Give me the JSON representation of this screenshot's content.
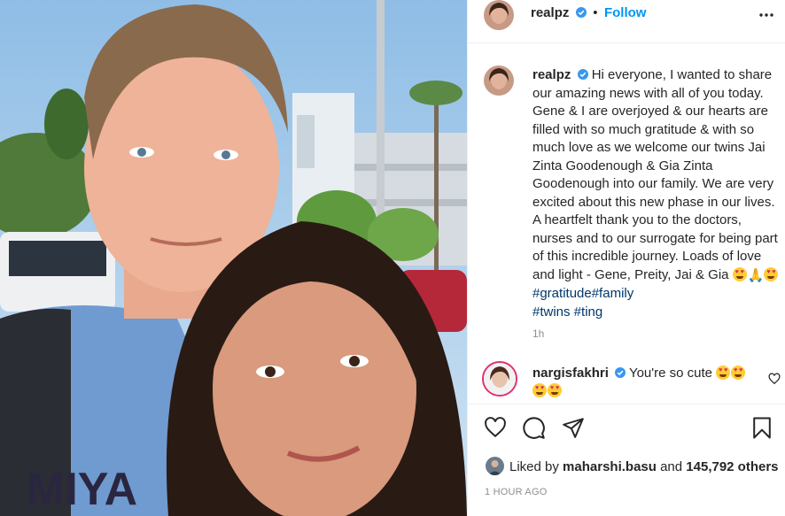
{
  "post": {
    "username": "realpz",
    "follow_label": "Follow",
    "caption_text": "Hi everyone, I wanted to share our amazing news with all of you today. Gene & I are overjoyed & our hearts are filled with so much gratitude & with so much love as we welcome our twins Jai Zinta Goodenough & Gia Zinta Goodenough into our family. We are very excited about this new phase in our lives. A heartfelt thank you to the doctors, nurses and to our surrogate for being part of this incredible journey. Loads of love and light - Gene, Preity, Jai & Gia",
    "hashtags_1": "#gratitude#family",
    "hashtags_2": "#twins #ting",
    "time_ago": "1h"
  },
  "comment": {
    "username": "nargisfakhri",
    "text": "You're so cute"
  },
  "likes": {
    "prefix": "Liked by",
    "user": "maharshi.basu",
    "middle": "and",
    "count": "145,792 others"
  },
  "post_date": "1 HOUR AGO",
  "icons": {
    "more": "more-options-icon",
    "like": "heart-icon",
    "comment": "comment-icon",
    "share": "share-icon",
    "save": "bookmark-icon",
    "verified": "verified-badge-icon"
  },
  "colors": {
    "link": "#0095f6",
    "hashtag": "#00376b",
    "verified": "#3897f0",
    "muted": "#8e8e8e"
  }
}
